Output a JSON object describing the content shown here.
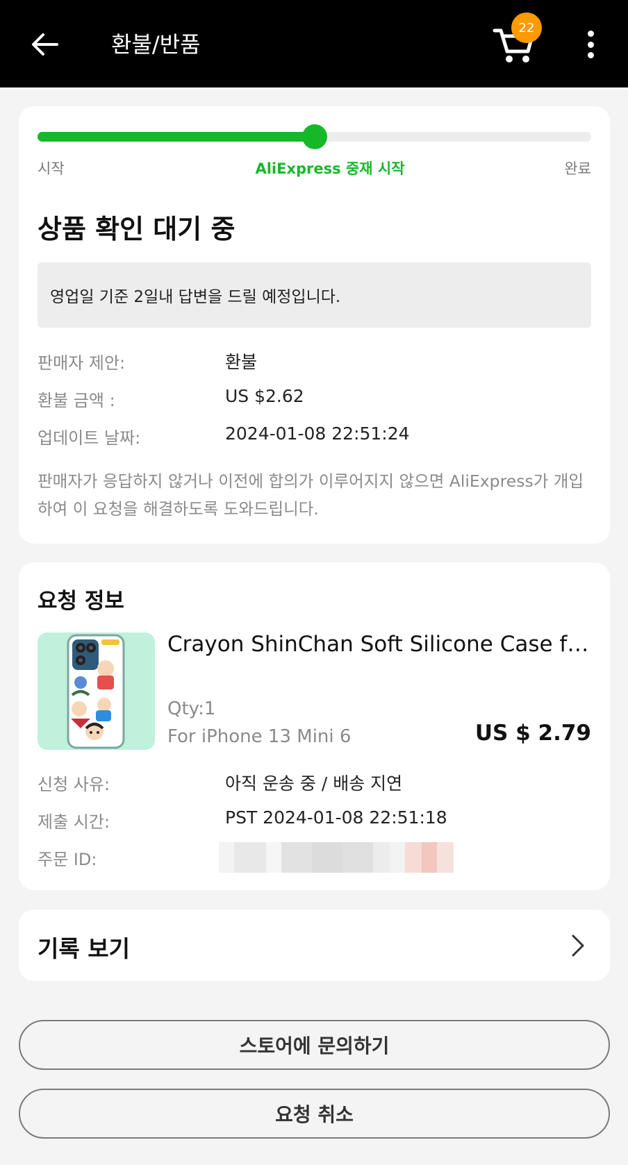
{
  "header": {
    "title": "환불/반품",
    "cart_count": "22"
  },
  "progress": {
    "fraction": 0.5,
    "steps": [
      {
        "label": "시작",
        "active": false
      },
      {
        "label": "AliExpress 중재 시작",
        "active": true
      },
      {
        "label": "완료",
        "active": false
      }
    ]
  },
  "status": {
    "title": "상품 확인 대기 중",
    "notice": "영업일 기준 2일내 답변을 드릴 예정입니다.",
    "fields": [
      {
        "label": "판매자 제안:",
        "value": "환불"
      },
      {
        "label": "환불 금액 :",
        "value": "US $2.62"
      },
      {
        "label": "업데이트 날짜:",
        "value": "2024-01-08 22:51:24"
      }
    ],
    "description": "판매자가 응답하지 않거나 이전에 합의가 이루어지지 않으면 AliExpress가 개입하여 이 요청을 해결하도록 도와드립니다."
  },
  "request": {
    "title": "요청 정보",
    "product": {
      "name": "Crayon ShinChan Soft Silicone Case for i...",
      "qty": "Qty:1",
      "variant": "For iPhone 13 Mini 6",
      "price": "US $ 2.79"
    },
    "fields": [
      {
        "label": "신청 사유:",
        "value": "아직 운송 중 / 배송 지연"
      },
      {
        "label": "제출 시간:",
        "value": "PST 2024-01-08 22:51:18"
      },
      {
        "label": "주문 ID:",
        "value": ""
      }
    ]
  },
  "history": {
    "label": "기록 보기"
  },
  "actions": {
    "contact_label": "스토어에 문의하기",
    "cancel_label": "요청 취소"
  },
  "colors": {
    "accent_green": "#16b829",
    "badge_orange": "#ff9a00",
    "header_bg": "#000000"
  }
}
